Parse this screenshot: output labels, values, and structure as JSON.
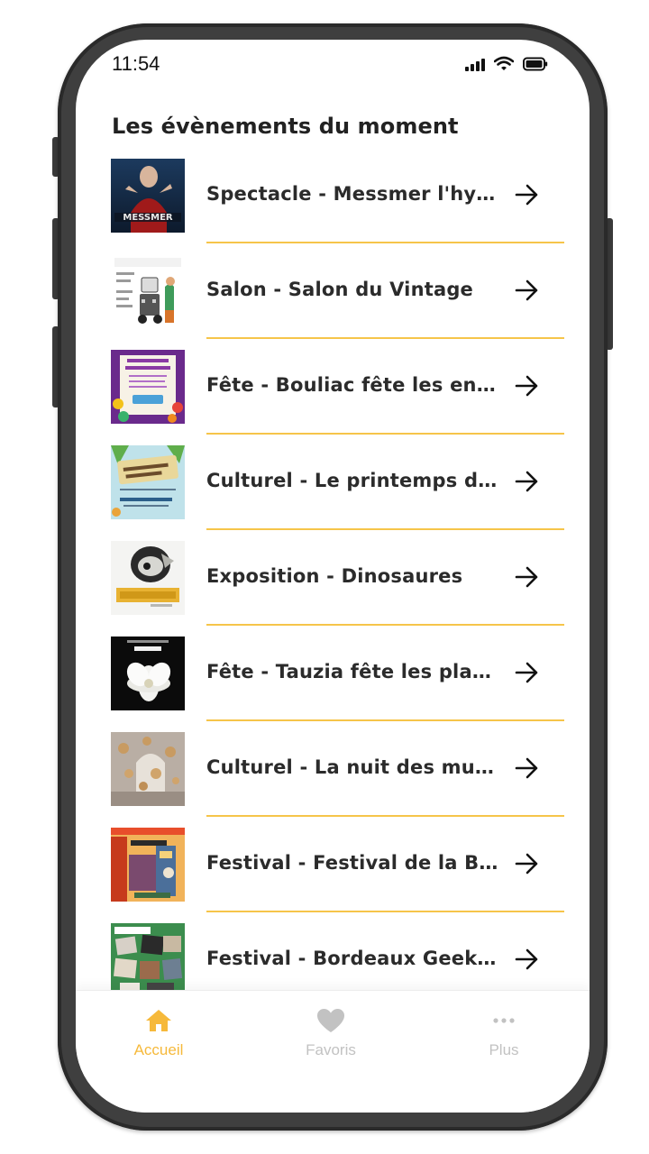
{
  "status_bar": {
    "time": "11:54",
    "icons": [
      "signal-icon",
      "wifi-icon",
      "battery-icon"
    ]
  },
  "main": {
    "title": "Les évènements du moment",
    "events": [
      {
        "label": "Spectacle - Messmer l'hyp…",
        "thumb_icon": "messmer-poster"
      },
      {
        "label": "Salon - Salon du Vintage",
        "thumb_icon": "vintage-poster"
      },
      {
        "label": "Fête - Bouliac fête les enf…",
        "thumb_icon": "bouliac-poster"
      },
      {
        "label": "Culturel - Le printemps de …",
        "thumb_icon": "printemps-poster"
      },
      {
        "label": "Exposition - Dinosaures",
        "thumb_icon": "dinosaures-poster"
      },
      {
        "label": "Fête - Tauzia fête les plant…",
        "thumb_icon": "tauzia-poster"
      },
      {
        "label": "Culturel - La nuit des musé…",
        "thumb_icon": "musees-poster"
      },
      {
        "label": "Festival - Festival de la BD…",
        "thumb_icon": "bd-poster"
      },
      {
        "label": "Festival - Bordeaux Geekf…",
        "thumb_icon": "geekfest-poster"
      }
    ]
  },
  "bottom_nav": {
    "items": [
      {
        "label": "Accueil",
        "icon": "home-icon",
        "active": true
      },
      {
        "label": "Favoris",
        "icon": "heart-icon",
        "active": false
      },
      {
        "label": "Plus",
        "icon": "more-icon",
        "active": false
      }
    ]
  },
  "colors": {
    "accent": "#f6b93b",
    "divider": "#f6c54a",
    "inactive": "#c2c2c2",
    "text": "#2b2b2b"
  }
}
